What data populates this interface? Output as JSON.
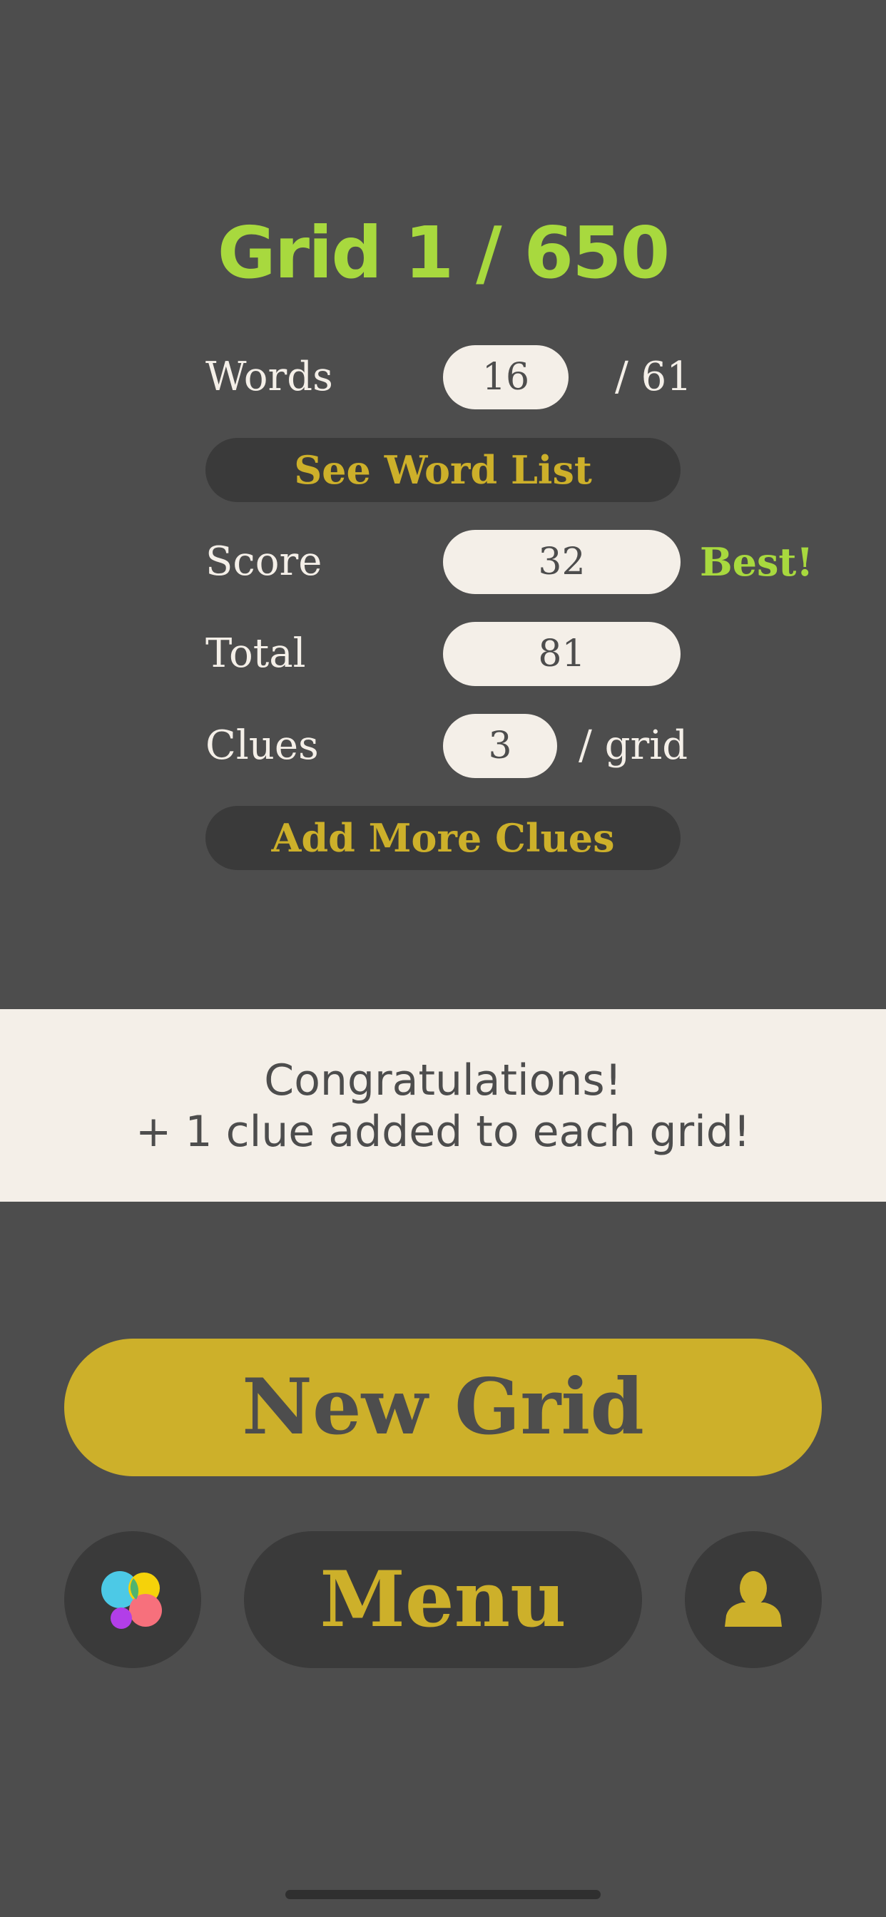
{
  "header": {
    "title": "Grid 1 / 650"
  },
  "stats": {
    "words_label": "Words",
    "words_value": "16",
    "words_suffix": "/ 61",
    "see_word_list": "See Word List",
    "score_label": "Score",
    "score_value": "32",
    "score_badge": "Best!",
    "total_label": "Total",
    "total_value": "81",
    "clues_label": "Clues",
    "clues_value": "3",
    "clues_suffix": "/ grid",
    "add_more_clues": "Add More Clues"
  },
  "banner": {
    "line1": "Congratulations!",
    "line2": "+ 1 clue added to each grid!"
  },
  "actions": {
    "new_grid": "New Grid",
    "menu": "Menu",
    "left_icon": "apps-logo-icon",
    "right_icon": "user-profile-icon"
  },
  "colors": {
    "background": "#4d4d4d",
    "accent_green": "#a8d93e",
    "accent_gold": "#cdb02a",
    "cream": "#f4efe8",
    "dark_button": "#3a3a3a"
  }
}
